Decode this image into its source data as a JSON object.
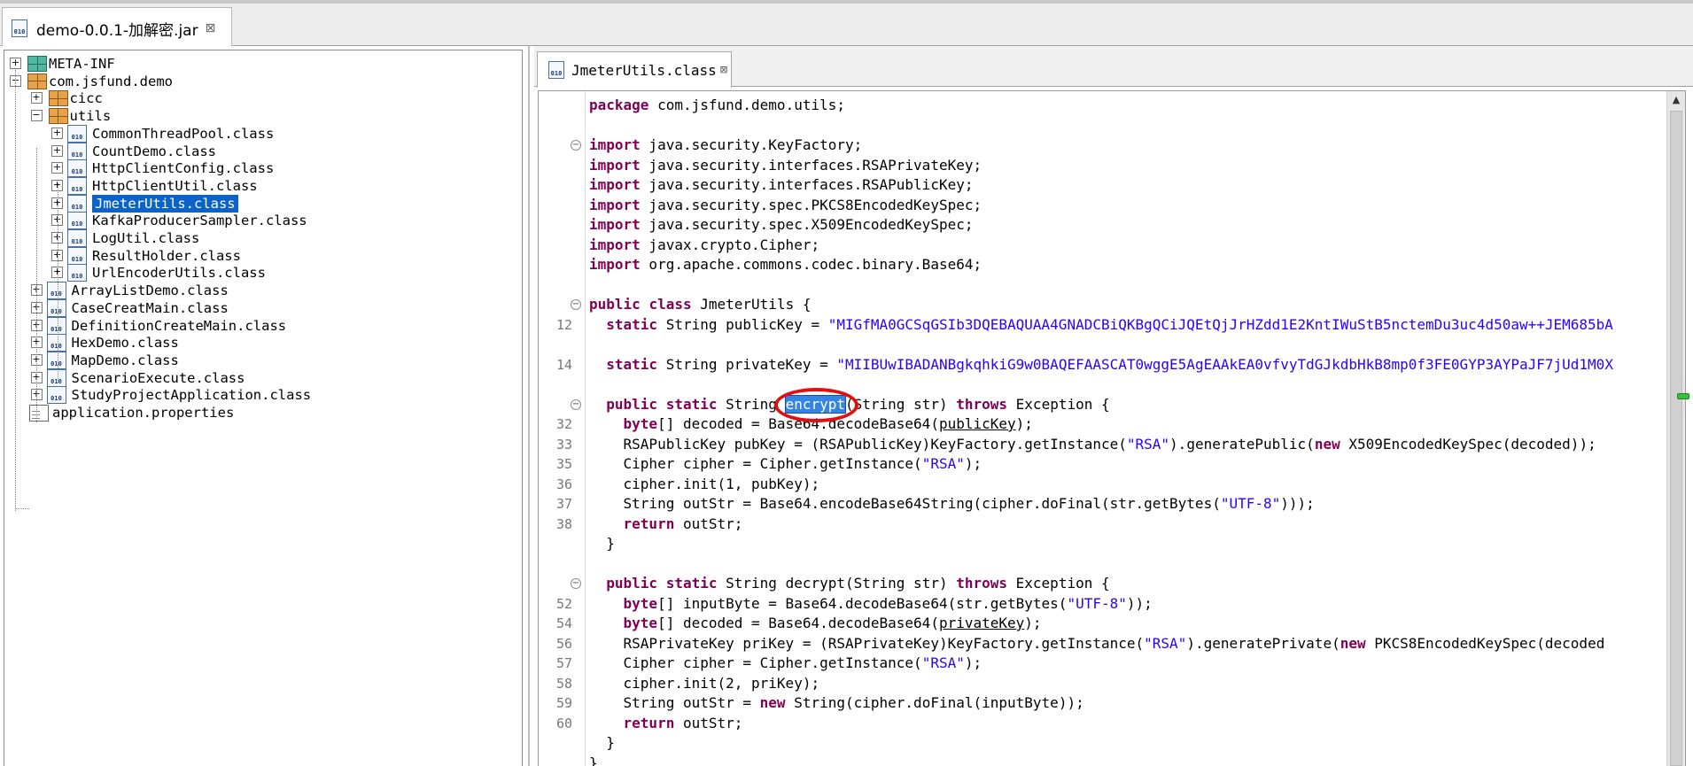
{
  "outer_tab": {
    "label": "demo-0.0.1-加解密.jar"
  },
  "tree": {
    "items": [
      {
        "label": "META-INF",
        "type": "meta"
      },
      {
        "label": "com.jsfund.demo",
        "type": "package"
      },
      {
        "label": "cicc",
        "type": "package"
      },
      {
        "label": "utils",
        "type": "package"
      },
      {
        "label": "CommonThreadPool.class",
        "type": "class"
      },
      {
        "label": "CountDemo.class",
        "type": "class"
      },
      {
        "label": "HttpClientConfig.class",
        "type": "class"
      },
      {
        "label": "HttpClientUtil.class",
        "type": "class"
      },
      {
        "label": "JmeterUtils.class",
        "type": "class",
        "selected": true
      },
      {
        "label": "KafkaProducerSampler.class",
        "type": "class"
      },
      {
        "label": "LogUtil.class",
        "type": "class"
      },
      {
        "label": "ResultHolder.class",
        "type": "class"
      },
      {
        "label": "UrlEncoderUtils.class",
        "type": "class"
      },
      {
        "label": "ArrayListDemo.class",
        "type": "class"
      },
      {
        "label": "CaseCreatMain.class",
        "type": "class"
      },
      {
        "label": "DefinitionCreateMain.class",
        "type": "class"
      },
      {
        "label": "HexDemo.class",
        "type": "class"
      },
      {
        "label": "MapDemo.class",
        "type": "class"
      },
      {
        "label": "ScenarioExecute.class",
        "type": "class"
      },
      {
        "label": "StudyProjectApplication.class",
        "type": "class"
      },
      {
        "label": "application.properties",
        "type": "file"
      }
    ]
  },
  "editor_tab": {
    "label": "JmeterUtils.class"
  },
  "code": {
    "line_numbers": [
      "",
      "",
      "",
      "",
      "",
      "",
      "",
      "",
      "",
      "",
      "",
      "12",
      "",
      "14",
      "",
      "",
      "32",
      "33",
      "35",
      "36",
      "37",
      "38",
      "",
      "",
      "",
      "52",
      "54",
      "56",
      "57",
      "58",
      "59",
      "60",
      "",
      ""
    ],
    "package_line": "package com.jsfund.demo.utils;",
    "imports": [
      "java.security.KeyFactory;",
      "java.security.interfaces.RSAPrivateKey;",
      "java.security.interfaces.RSAPublicKey;",
      "java.security.spec.PKCS8EncodedKeySpec;",
      "java.security.spec.X509EncodedKeySpec;",
      "javax.crypto.Cipher;",
      "org.apache.commons.codec.binary.Base64;"
    ],
    "class_name": "JmeterUtils",
    "public_key_value": "\"MIGfMA0GCSqGSIb3DQEBAQUAA4GNADCBiQKBgQCiJQEtQjJrHZdd1E2KntIWuStB5nctemDu3uc4d50aw++JEM685bA",
    "private_key_value": "\"MIIBUwIBADANBgkqhkiG9w0BAQEFAASCAT0wggE5AgEAAkEA0vfvyTdGJkdbHkB8mp0f3FE0GYP3AYPaJF7jUd1M0X",
    "encrypt_name": "encrypt",
    "decrypt_name": "decrypt"
  },
  "colors": {
    "keyword": "#7f0055",
    "string": "#2a00ff",
    "selection": "#0b63c9",
    "annotation_circle": "#e01010"
  }
}
